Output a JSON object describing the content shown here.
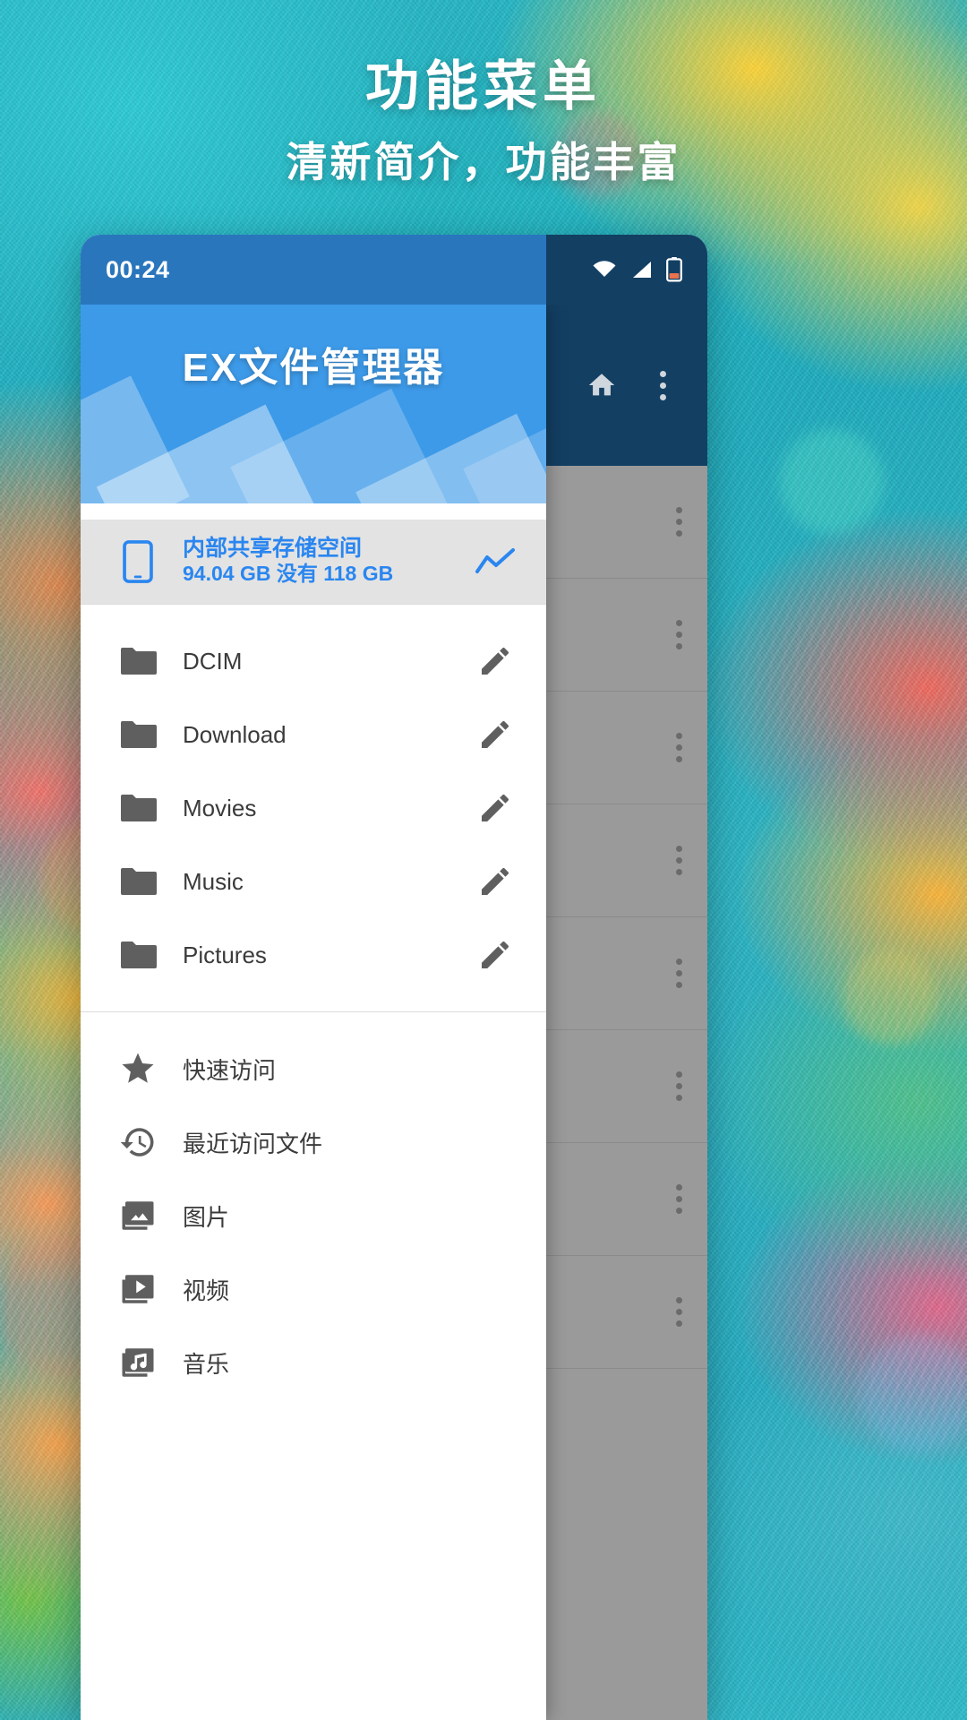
{
  "promo": {
    "title": "功能菜单",
    "subtitle": "清新简介，功能丰富"
  },
  "statusbar": {
    "clock": "00:24",
    "icons": [
      "wifi-icon",
      "signal-icon",
      "battery-icon"
    ],
    "bg_color": "#2a76bd"
  },
  "app": {
    "title": "EX文件管理器",
    "header_color": "#3d9ae8",
    "accent_color": "#2a86f0",
    "toolbar_color": "#133f63"
  },
  "toolbar": {
    "home_label": "home-icon",
    "overflow_label": "overflow-menu-icon"
  },
  "storage": {
    "icon": "phone-icon",
    "title": "内部共享存储空间",
    "subtitle": "94.04 GB 没有 118 GB",
    "chart_icon": "trending-up-icon"
  },
  "folders": [
    {
      "icon": "folder-icon",
      "label": "DCIM",
      "action": "edit-pencil-icon"
    },
    {
      "icon": "folder-icon",
      "label": "Download",
      "action": "edit-pencil-icon"
    },
    {
      "icon": "folder-icon",
      "label": "Movies",
      "action": "edit-pencil-icon"
    },
    {
      "icon": "folder-icon",
      "label": "Music",
      "action": "edit-pencil-icon"
    },
    {
      "icon": "folder-icon",
      "label": "Pictures",
      "action": "edit-pencil-icon"
    }
  ],
  "shortcuts": [
    {
      "icon": "star-icon",
      "label": "快速访问"
    },
    {
      "icon": "history-icon",
      "label": "最近访问文件"
    },
    {
      "icon": "image-icon",
      "label": "图片"
    },
    {
      "icon": "video-icon",
      "label": "视频"
    },
    {
      "icon": "music-icon",
      "label": "音乐"
    }
  ]
}
